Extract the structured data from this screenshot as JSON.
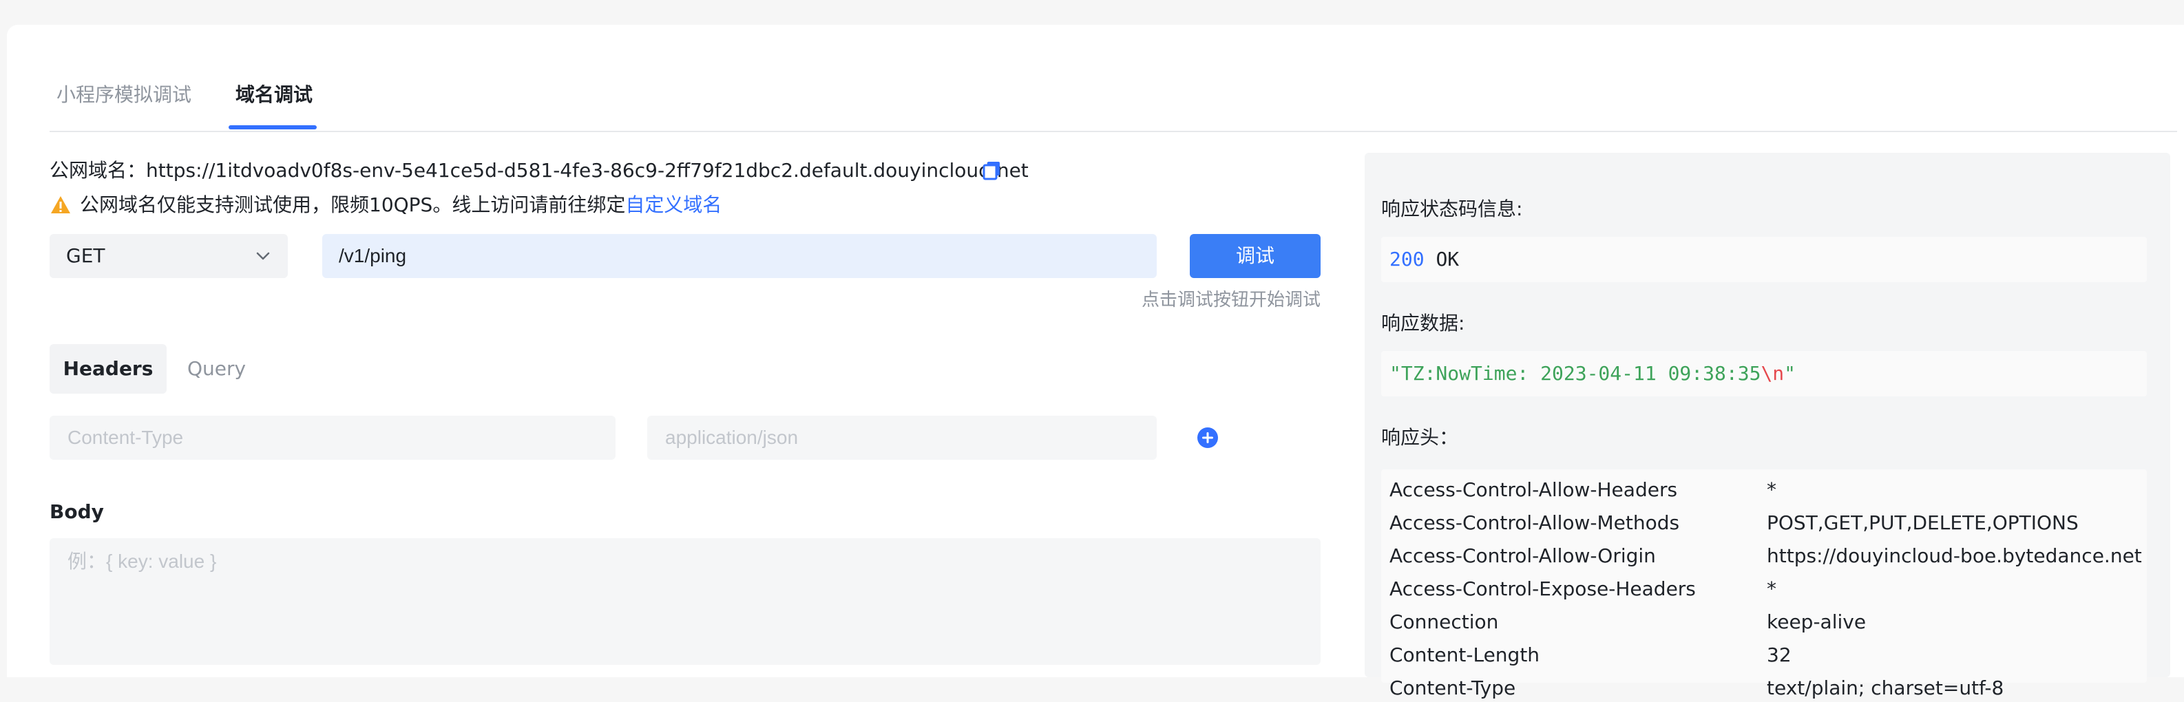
{
  "tabs": [
    {
      "label": "小程序模拟调试",
      "active": false
    },
    {
      "label": "域名调试",
      "active": true
    }
  ],
  "domain": {
    "label": "公网域名：",
    "url": "https://1itdvoadv0f8s-env-5e41ce5d-d581-4fe3-86c9-2ff79f21dbc2.default.douyincloud.net",
    "copy_icon": "copy-icon"
  },
  "warning": {
    "icon": "warning-icon",
    "text": "公网域名仅能支持测试使用，限频10QPS。线上访问请前往绑定",
    "link_text": "自定义域名"
  },
  "request": {
    "method": "GET",
    "path": "/v1/ping",
    "button_label": "调试",
    "hint": "点击调试按钮开始调试"
  },
  "subtabs": [
    {
      "label": "Headers",
      "active": true
    },
    {
      "label": "Query",
      "active": false
    }
  ],
  "headers_inputs": {
    "key_placeholder": "Content-Type",
    "value_placeholder": "application/json",
    "add_icon": "plus-circle-icon"
  },
  "body": {
    "label": "Body",
    "placeholder": "例：{ key: value }"
  },
  "response": {
    "status_label": "响应状态码信息:",
    "status_code": "200",
    "status_text": "OK",
    "data_label": "响应数据:",
    "data_string_prefix": "\"TZ:NowTime: 2023-04-11 09:38:35",
    "data_escape": "\\n",
    "data_string_suffix": "\"",
    "headers_label": "响应头：",
    "headers": [
      {
        "key": "Access-Control-Allow-Headers",
        "value": "*"
      },
      {
        "key": "Access-Control-Allow-Methods",
        "value": "POST,GET,PUT,DELETE,OPTIONS"
      },
      {
        "key": "Access-Control-Allow-Origin",
        "value": "https://douyincloud-boe.bytedance.net"
      },
      {
        "key": "Access-Control-Expose-Headers",
        "value": "*"
      },
      {
        "key": "Connection",
        "value": "keep-alive"
      },
      {
        "key": "Content-Length",
        "value": "32"
      },
      {
        "key": "Content-Type",
        "value": "text/plain; charset=utf-8"
      }
    ]
  },
  "colors": {
    "accent": "#3370ff",
    "button": "#3a7ef6",
    "warning": "#f5a623",
    "string": "#3ea35a",
    "escape": "#e5484d"
  }
}
